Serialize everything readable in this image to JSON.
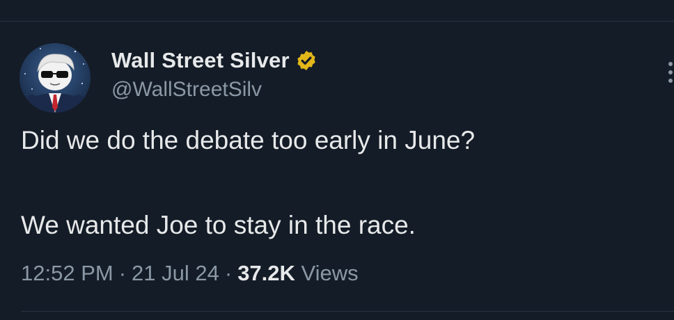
{
  "author": {
    "display_name": "Wall Street Silver",
    "handle": "@WallStreetSilv",
    "verified": true,
    "badge_color": "#e2b719"
  },
  "tweet": {
    "line1": "Did we do the debate too early in June?",
    "line2": "We wanted Joe to stay in the race."
  },
  "meta": {
    "time": "12:52 PM",
    "separator": "·",
    "date": "21 Jul 24",
    "views_count": "37.2K",
    "views_label": "Views"
  },
  "icons": {
    "avatar": "avatar-image",
    "verified": "verified-badge-icon",
    "more": "more-options-icon"
  },
  "theme": {
    "background": "#141c27",
    "text_primary": "#e7e9ea",
    "text_secondary": "#8b98a5"
  }
}
